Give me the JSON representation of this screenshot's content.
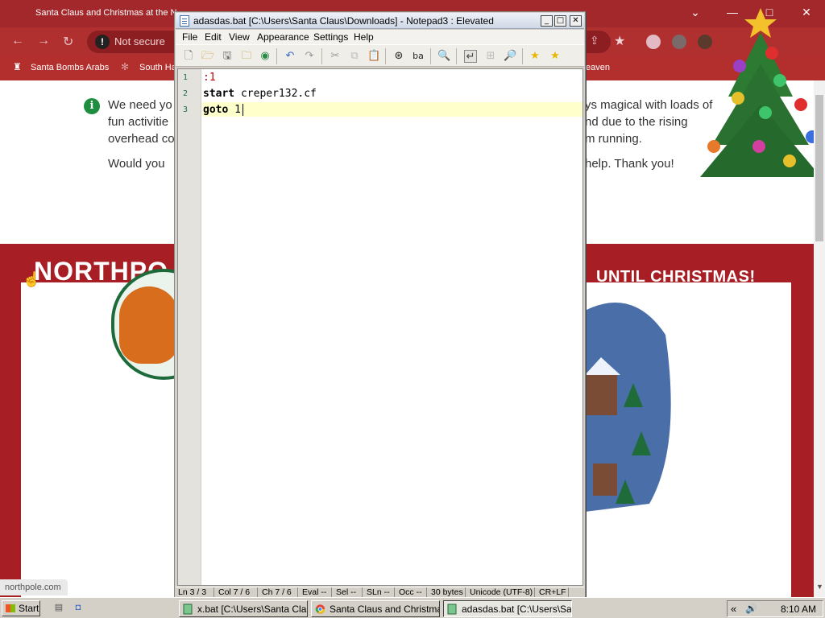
{
  "browser": {
    "tab_title": "Santa Claus and Christmas at the N",
    "controls": [
      "⌄",
      "—",
      "□",
      "✕"
    ],
    "address_warning": "Not secure",
    "bookmarks": [
      "Santa Bombs Arabs",
      "South Ha",
      "eaven"
    ]
  },
  "page": {
    "message_lines": [
      "We need yo",
      "fun activitie",
      "overhead co",
      "Would you",
      "ys magical with loads of",
      "nd due to the rising",
      "m running.",
      "help. Thank you!"
    ],
    "banner_left": "NORTHPO",
    "banner_right": "UNTIL CHRISTMAS!",
    "status_url": "northpole.com"
  },
  "notepad": {
    "title": "adasdas.bat [C:\\Users\\Santa Claus\\Downloads] - Notepad3 : Elevated",
    "menu": [
      "File",
      "Edit",
      "View",
      "Appearance",
      "Settings",
      "Help"
    ],
    "lines": [
      {
        "num": "1",
        "label": ":1"
      },
      {
        "num": "2",
        "keyword": "start",
        "rest": " creper132.cf"
      },
      {
        "num": "3",
        "keyword": "goto",
        "rest": " 1"
      }
    ],
    "status": [
      "Ln 3 / 3",
      "Col 7 / 6",
      "Ch 7 / 6",
      "Eval --",
      "Sel --",
      "SLn --",
      "Occ --",
      "30 bytes",
      "Unicode (UTF-8)",
      "CR+LF"
    ]
  },
  "taskbar": {
    "start_label": "Start",
    "tasks": [
      {
        "label": "x.bat [C:\\Users\\Santa Cla...",
        "icon": "notepad-icon"
      },
      {
        "label": "Santa Claus and Christma...",
        "icon": "chrome-icon"
      },
      {
        "label": "adasdas.bat [C:\\Users\\Sa...",
        "icon": "notepad-icon"
      }
    ],
    "time": "8:10 AM"
  },
  "colors": {
    "browser_red": "#a3282b",
    "banner_red": "#a71f25",
    "current_line": "#ffffcc",
    "gutter_number": "#1f6b5b"
  }
}
